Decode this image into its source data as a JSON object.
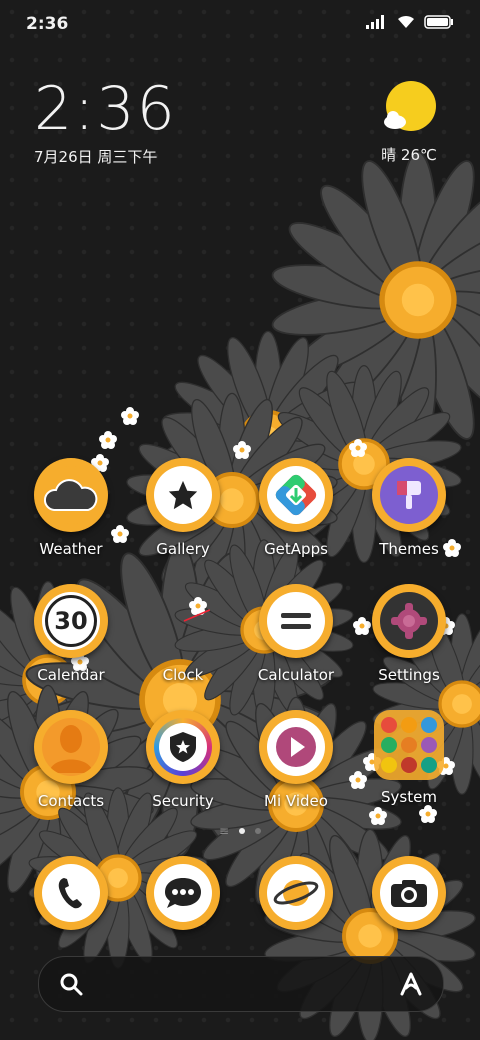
{
  "status_bar": {
    "time": "2:36"
  },
  "clock_widget": {
    "time": "2:36",
    "date": "7月26日 周三下午"
  },
  "weather_widget": {
    "text": "晴 26℃"
  },
  "apps": [
    {
      "label": "Weather",
      "icon": "cloud-icon"
    },
    {
      "label": "Gallery",
      "icon": "star-icon"
    },
    {
      "label": "GetApps",
      "icon": "getapps-icon"
    },
    {
      "label": "Themes",
      "icon": "brush-icon"
    },
    {
      "label": "Calendar",
      "icon": "calendar-icon",
      "badge": "30"
    },
    {
      "label": "Clock",
      "icon": "clock-icon"
    },
    {
      "label": "Calculator",
      "icon": "equals-icon"
    },
    {
      "label": "Settings",
      "icon": "gear-icon"
    },
    {
      "label": "Contacts",
      "icon": "person-icon"
    },
    {
      "label": "Security",
      "icon": "shield-icon"
    },
    {
      "label": "Mi Video",
      "icon": "play-icon"
    },
    {
      "label": "System",
      "icon": "folder-icon"
    }
  ],
  "dock": [
    {
      "icon": "phone-icon"
    },
    {
      "icon": "message-icon"
    },
    {
      "icon": "browser-icon"
    },
    {
      "icon": "camera-icon"
    }
  ],
  "colors": {
    "accent": "#f6ad2d",
    "flower": "#4a4a4a"
  }
}
